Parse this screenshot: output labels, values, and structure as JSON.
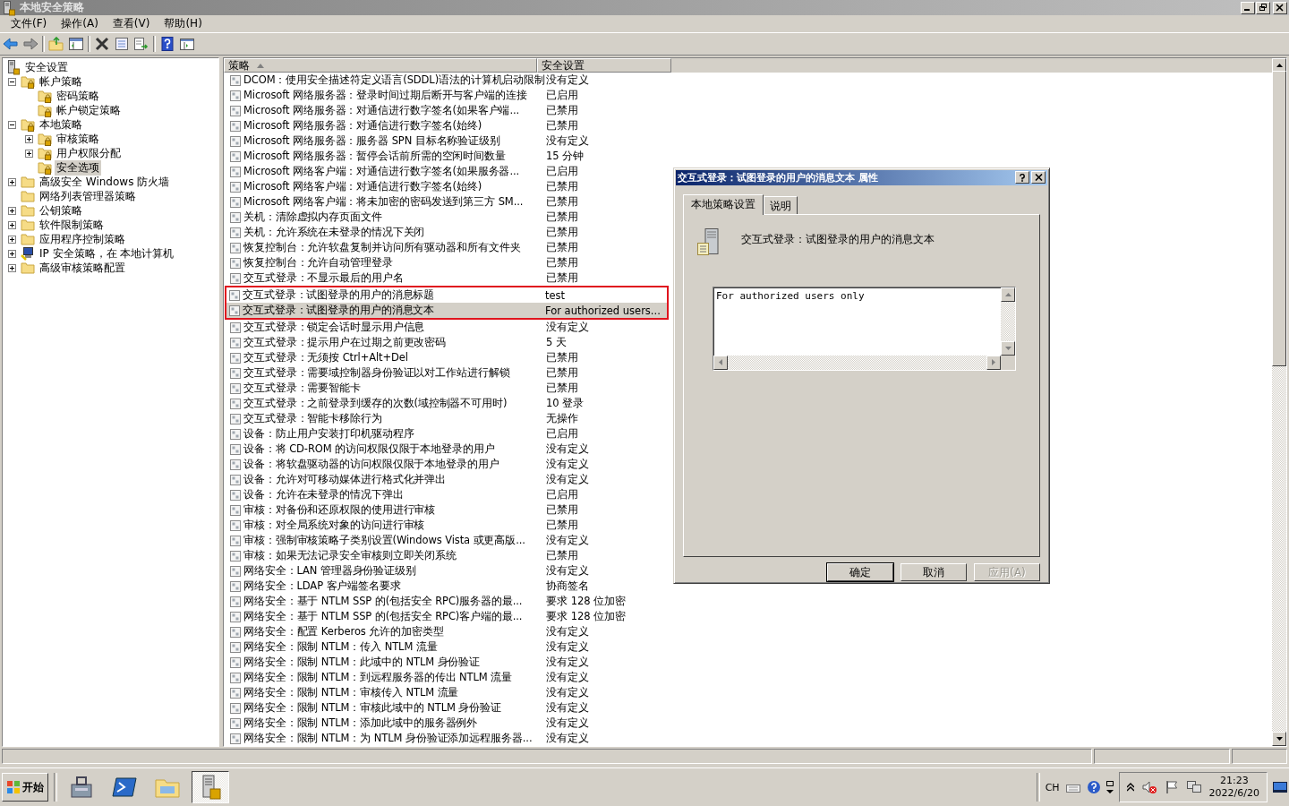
{
  "window": {
    "title": "本地安全策略"
  },
  "menu": [
    "文件(F)",
    "操作(A)",
    "查看(V)",
    "帮助(H)"
  ],
  "tree": [
    {
      "label": "安全设置",
      "kind": "server",
      "selected": false,
      "children": [
        {
          "label": "帐户策略",
          "kind": "lockfolder",
          "expanded": true,
          "selected": false,
          "children": [
            {
              "label": "密码策略",
              "kind": "lockfolder",
              "selected": false
            },
            {
              "label": "帐户锁定策略",
              "kind": "lockfolder",
              "selected": false
            }
          ]
        },
        {
          "label": "本地策略",
          "kind": "lockfolder",
          "expanded": true,
          "selected": false,
          "children": [
            {
              "label": "审核策略",
              "kind": "lockfolder",
              "expanded": false,
              "selected": false
            },
            {
              "label": "用户权限分配",
              "kind": "lockfolder",
              "expanded": false,
              "selected": false
            },
            {
              "label": "安全选项",
              "kind": "lockfolder",
              "selected": true
            }
          ]
        },
        {
          "label": "高级安全 Windows 防火墙",
          "kind": "folder",
          "expanded": false,
          "selected": false
        },
        {
          "label": "网络列表管理器策略",
          "kind": "folder",
          "selected": false
        },
        {
          "label": "公钥策略",
          "kind": "folder",
          "expanded": false,
          "selected": false
        },
        {
          "label": "软件限制策略",
          "kind": "folder",
          "expanded": false,
          "selected": false
        },
        {
          "label": "应用程序控制策略",
          "kind": "folder",
          "expanded": false,
          "selected": false
        },
        {
          "label": "IP 安全策略，在 本地计算机",
          "kind": "ipsec",
          "expanded": false,
          "selected": false
        },
        {
          "label": "高级审核策略配置",
          "kind": "folder",
          "expanded": false,
          "selected": false
        }
      ]
    }
  ],
  "table": {
    "columns": [
      "策略",
      "安全设置"
    ],
    "rows": [
      {
        "policy": "DCOM：使用安全描述符定义语言(SDDL)语法的计算机启动限制",
        "setting": "没有定义",
        "selected": false,
        "flagged": false
      },
      {
        "policy": "Microsoft 网络服务器：登录时间过期后断开与客户端的连接",
        "setting": "已启用",
        "selected": false,
        "flagged": false
      },
      {
        "policy": "Microsoft 网络服务器：对通信进行数字签名(如果客户端...",
        "setting": "已禁用",
        "selected": false,
        "flagged": false
      },
      {
        "policy": "Microsoft 网络服务器：对通信进行数字签名(始终)",
        "setting": "已禁用",
        "selected": false,
        "flagged": false
      },
      {
        "policy": "Microsoft 网络服务器：服务器 SPN 目标名称验证级别",
        "setting": "没有定义",
        "selected": false,
        "flagged": false
      },
      {
        "policy": "Microsoft 网络服务器：暂停会话前所需的空闲时间数量",
        "setting": "15 分钟",
        "selected": false,
        "flagged": false
      },
      {
        "policy": "Microsoft 网络客户端：对通信进行数字签名(如果服务器...",
        "setting": "已启用",
        "selected": false,
        "flagged": false
      },
      {
        "policy": "Microsoft 网络客户端：对通信进行数字签名(始终)",
        "setting": "已禁用",
        "selected": false,
        "flagged": false
      },
      {
        "policy": "Microsoft 网络客户端：将未加密的密码发送到第三方 SM...",
        "setting": "已禁用",
        "selected": false,
        "flagged": false
      },
      {
        "policy": "关机：清除虚拟内存页面文件",
        "setting": "已禁用",
        "selected": false,
        "flagged": false
      },
      {
        "policy": "关机：允许系统在未登录的情况下关闭",
        "setting": "已禁用",
        "selected": false,
        "flagged": false
      },
      {
        "policy": "恢复控制台：允许软盘复制并访问所有驱动器和所有文件夹",
        "setting": "已禁用",
        "selected": false,
        "flagged": false
      },
      {
        "policy": "恢复控制台：允许自动管理登录",
        "setting": "已禁用",
        "selected": false,
        "flagged": false
      },
      {
        "policy": "交互式登录：不显示最后的用户名",
        "setting": "已禁用",
        "selected": false,
        "flagged": false
      },
      {
        "policy": "交互式登录：试图登录的用户的消息标题",
        "setting": "test",
        "selected": false,
        "flagged": true
      },
      {
        "policy": "交互式登录：试图登录的用户的消息文本",
        "setting": "For authorized users...",
        "selected": true,
        "flagged": true
      },
      {
        "policy": "交互式登录：锁定会话时显示用户信息",
        "setting": "没有定义",
        "selected": false,
        "flagged": false
      },
      {
        "policy": "交互式登录：提示用户在过期之前更改密码",
        "setting": "5 天",
        "selected": false,
        "flagged": false
      },
      {
        "policy": "交互式登录：无须按 Ctrl+Alt+Del",
        "setting": "已禁用",
        "selected": false,
        "flagged": false
      },
      {
        "policy": "交互式登录：需要域控制器身份验证以对工作站进行解锁",
        "setting": "已禁用",
        "selected": false,
        "flagged": false
      },
      {
        "policy": "交互式登录：需要智能卡",
        "setting": "已禁用",
        "selected": false,
        "flagged": false
      },
      {
        "policy": "交互式登录：之前登录到缓存的次数(域控制器不可用时)",
        "setting": "10 登录",
        "selected": false,
        "flagged": false
      },
      {
        "policy": "交互式登录：智能卡移除行为",
        "setting": "无操作",
        "selected": false,
        "flagged": false
      },
      {
        "policy": "设备：防止用户安装打印机驱动程序",
        "setting": "已启用",
        "selected": false,
        "flagged": false
      },
      {
        "policy": "设备：将 CD-ROM 的访问权限仅限于本地登录的用户",
        "setting": "没有定义",
        "selected": false,
        "flagged": false
      },
      {
        "policy": "设备：将软盘驱动器的访问权限仅限于本地登录的用户",
        "setting": "没有定义",
        "selected": false,
        "flagged": false
      },
      {
        "policy": "设备：允许对可移动媒体进行格式化并弹出",
        "setting": "没有定义",
        "selected": false,
        "flagged": false
      },
      {
        "policy": "设备：允许在未登录的情况下弹出",
        "setting": "已启用",
        "selected": false,
        "flagged": false
      },
      {
        "policy": "审核：对备份和还原权限的使用进行审核",
        "setting": "已禁用",
        "selected": false,
        "flagged": false
      },
      {
        "policy": "审核：对全局系统对象的访问进行审核",
        "setting": "已禁用",
        "selected": false,
        "flagged": false
      },
      {
        "policy": "审核：强制审核策略子类别设置(Windows Vista 或更高版...",
        "setting": "没有定义",
        "selected": false,
        "flagged": false
      },
      {
        "policy": "审核：如果无法记录安全审核则立即关闭系统",
        "setting": "已禁用",
        "selected": false,
        "flagged": false
      },
      {
        "policy": "网络安全：LAN 管理器身份验证级别",
        "setting": "没有定义",
        "selected": false,
        "flagged": false
      },
      {
        "policy": "网络安全：LDAP 客户端签名要求",
        "setting": "协商签名",
        "selected": false,
        "flagged": false
      },
      {
        "policy": "网络安全：基于 NTLM SSP 的(包括安全 RPC)服务器的最...",
        "setting": "要求 128 位加密",
        "selected": false,
        "flagged": false
      },
      {
        "policy": "网络安全：基于 NTLM SSP 的(包括安全 RPC)客户端的最...",
        "setting": "要求 128 位加密",
        "selected": false,
        "flagged": false
      },
      {
        "policy": "网络安全：配置 Kerberos 允许的加密类型",
        "setting": "没有定义",
        "selected": false,
        "flagged": false
      },
      {
        "policy": "网络安全：限制 NTLM：传入 NTLM 流量",
        "setting": "没有定义",
        "selected": false,
        "flagged": false
      },
      {
        "policy": "网络安全：限制 NTLM：此域中的 NTLM 身份验证",
        "setting": "没有定义",
        "selected": false,
        "flagged": false
      },
      {
        "policy": "网络安全：限制 NTLM：到远程服务器的传出 NTLM 流量",
        "setting": "没有定义",
        "selected": false,
        "flagged": false
      },
      {
        "policy": "网络安全：限制 NTLM：审核传入 NTLM 流量",
        "setting": "没有定义",
        "selected": false,
        "flagged": false
      },
      {
        "policy": "网络安全：限制 NTLM：审核此域中的 NTLM 身份验证",
        "setting": "没有定义",
        "selected": false,
        "flagged": false
      },
      {
        "policy": "网络安全：限制 NTLM：添加此域中的服务器例外",
        "setting": "没有定义",
        "selected": false,
        "flagged": false
      },
      {
        "policy": "网络安全：限制 NTLM：为 NTLM 身份验证添加远程服务器...",
        "setting": "没有定义",
        "selected": false,
        "flagged": false
      }
    ]
  },
  "dialog": {
    "title": "交互式登录：试图登录的用户的消息文本 属性",
    "tabs": [
      {
        "label": "本地策略设置",
        "selected": true
      },
      {
        "label": "说明",
        "selected": false
      }
    ],
    "policy_name": "交互式登录：试图登录的用户的消息文本",
    "value": "For authorized users only",
    "buttons": [
      {
        "label": "确定",
        "default": true,
        "disabled": false
      },
      {
        "label": "取消",
        "default": false,
        "disabled": false
      },
      {
        "label": "应用(A)",
        "default": false,
        "disabled": true
      }
    ]
  },
  "taskbar": {
    "start": "开始",
    "apps": [
      {
        "kind": "toolbox",
        "selected": false
      },
      {
        "kind": "terminal",
        "selected": false
      },
      {
        "kind": "explorer",
        "selected": false
      },
      {
        "kind": "server",
        "selected": true
      }
    ],
    "language": "CH",
    "time": "21:23",
    "date": "2022/6/20"
  }
}
